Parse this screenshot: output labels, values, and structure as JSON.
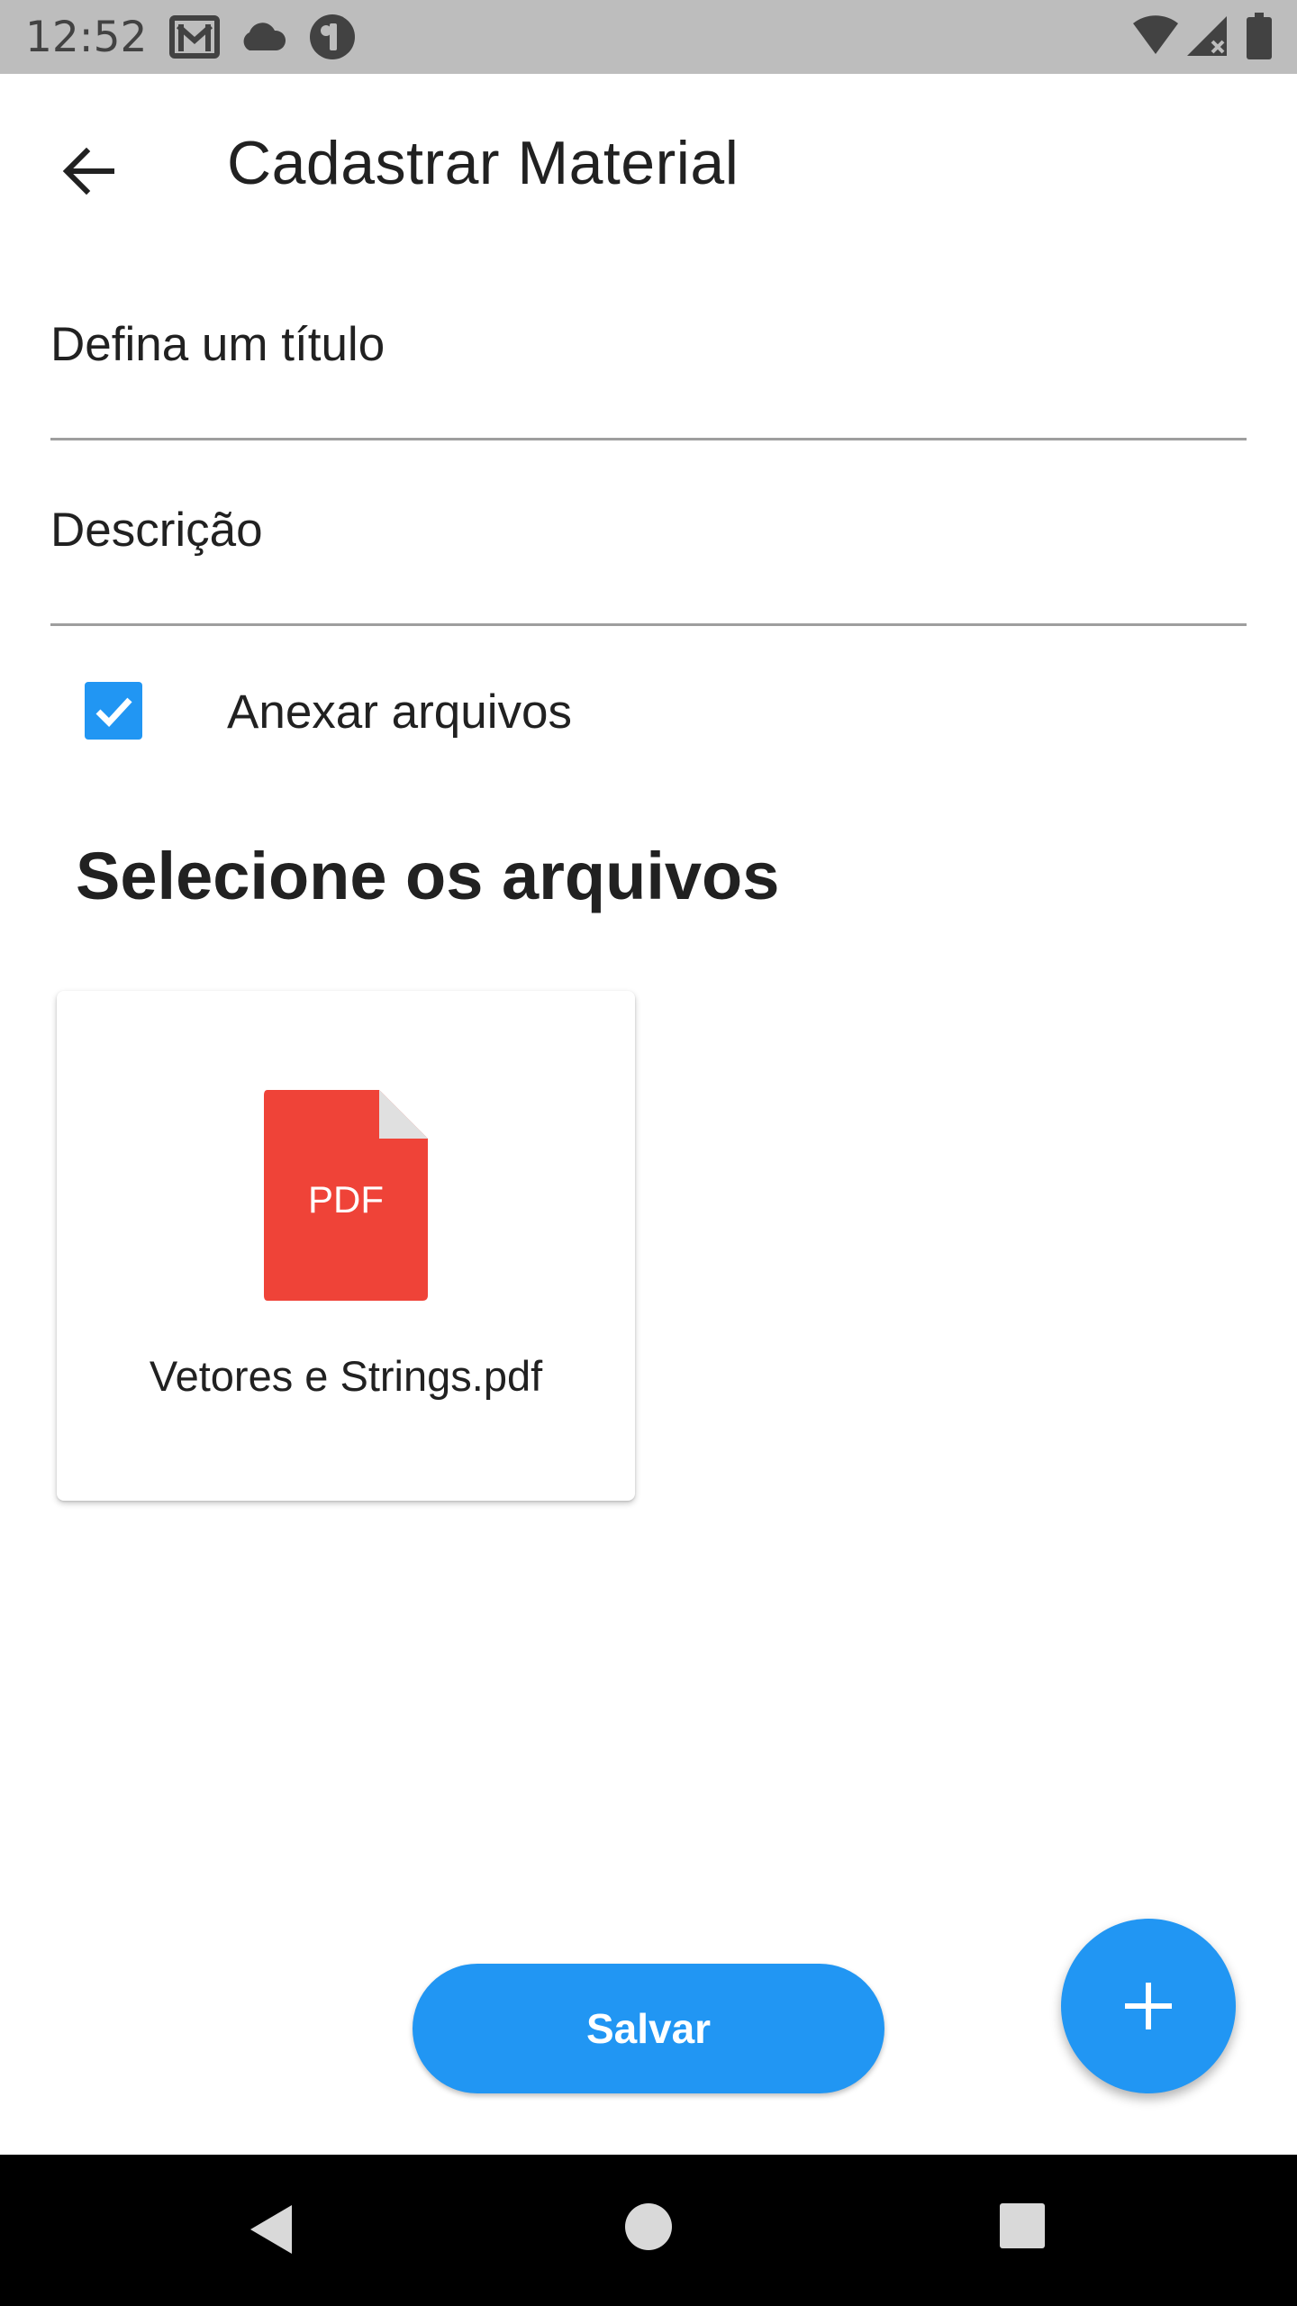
{
  "status_bar": {
    "time": "12:52",
    "left_icons": [
      "gmail-icon",
      "cloud-icon",
      "app-notification-icon"
    ],
    "right_icons": [
      "wifi-icon",
      "cell-signal-icon",
      "battery-icon"
    ]
  },
  "app_bar": {
    "title": "Cadastrar Material",
    "back_icon": "arrow-back-icon"
  },
  "form": {
    "title_label": "Defina um título",
    "description_label": "Descrição",
    "attach_label": "Anexar arquivos",
    "attach_checked": true
  },
  "files_section": {
    "heading": "Selecione os arquivos",
    "files": [
      {
        "icon_text": "PDF",
        "name": "Vetores e Strings.pdf"
      }
    ]
  },
  "actions": {
    "save_label": "Salvar",
    "fab_icon": "plus-icon"
  },
  "colors": {
    "accent": "#2196F3",
    "pdf_red": "#EF4338",
    "status_bar": "#BDBDBD",
    "nav_bar": "#000000"
  },
  "nav_bar": {
    "buttons": [
      "back-triangle-icon",
      "home-circle-icon",
      "recents-square-icon"
    ]
  }
}
